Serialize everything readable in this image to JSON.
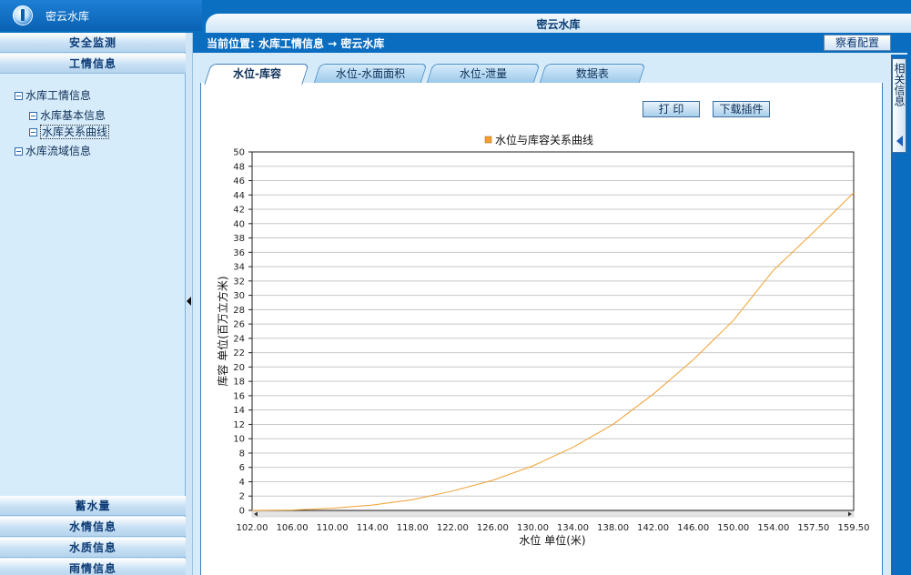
{
  "app": {
    "title": "密云水库",
    "page_title": "密云水库"
  },
  "sidebar": {
    "top_headers": [
      "安全监测",
      "工情信息"
    ],
    "tree": [
      {
        "label": "水库工情信息",
        "level": 0
      },
      {
        "label": "水库基本信息",
        "level": 1
      },
      {
        "label": "水库关系曲线",
        "level": 1,
        "selected": true
      },
      {
        "label": "水库流域信息",
        "level": 0
      }
    ],
    "bottom_headers": [
      "蓄水量",
      "水情信息",
      "水质信息",
      "雨情信息"
    ]
  },
  "header": {
    "breadcrumb": "当前位置: 水库工情信息 → 密云水库",
    "config_button": "察看配置"
  },
  "tabs": [
    {
      "label": "水位-库容",
      "active": true
    },
    {
      "label": "水位-水面面积",
      "active": false
    },
    {
      "label": "水位-泄量",
      "active": false
    },
    {
      "label": "数据表",
      "active": false
    }
  ],
  "toolbar": {
    "print_label": "打 印",
    "download_label": "下载插件"
  },
  "rightbar": {
    "label": "相关信息"
  },
  "chart_data": {
    "type": "line",
    "legend": [
      "水位与库容关系曲线"
    ],
    "legend_position": "top-center",
    "xlabel": "水位 单位(米)",
    "ylabel": "库容 单位(百万立方米)",
    "ylim": [
      0,
      50
    ],
    "grid": true,
    "x_tick_labels": [
      "102.00",
      "106.00",
      "110.00",
      "114.00",
      "118.00",
      "122.00",
      "126.00",
      "130.00",
      "134.00",
      "138.00",
      "142.00",
      "146.00",
      "150.00",
      "154.00",
      "157.50",
      "159.50"
    ],
    "y_ticks": [
      0,
      2,
      4,
      6,
      8,
      10,
      12,
      14,
      16,
      18,
      20,
      22,
      24,
      26,
      28,
      30,
      32,
      34,
      36,
      38,
      40,
      42,
      44,
      46,
      48,
      50
    ],
    "series": [
      {
        "name": "水位与库容关系曲线",
        "color": "#f0a030",
        "x": [
          "102.00",
          "106.00",
          "110.00",
          "114.00",
          "118.00",
          "122.00",
          "126.00",
          "130.00",
          "134.00",
          "138.00",
          "142.00",
          "146.00",
          "150.00",
          "154.00",
          "157.50",
          "159.50"
        ],
        "values": [
          0,
          0.05,
          0.3,
          0.75,
          1.5,
          2.7,
          4.2,
          6.2,
          8.8,
          12.0,
          16.2,
          21.0,
          26.5,
          33.5,
          38.8,
          44.3
        ]
      }
    ]
  }
}
